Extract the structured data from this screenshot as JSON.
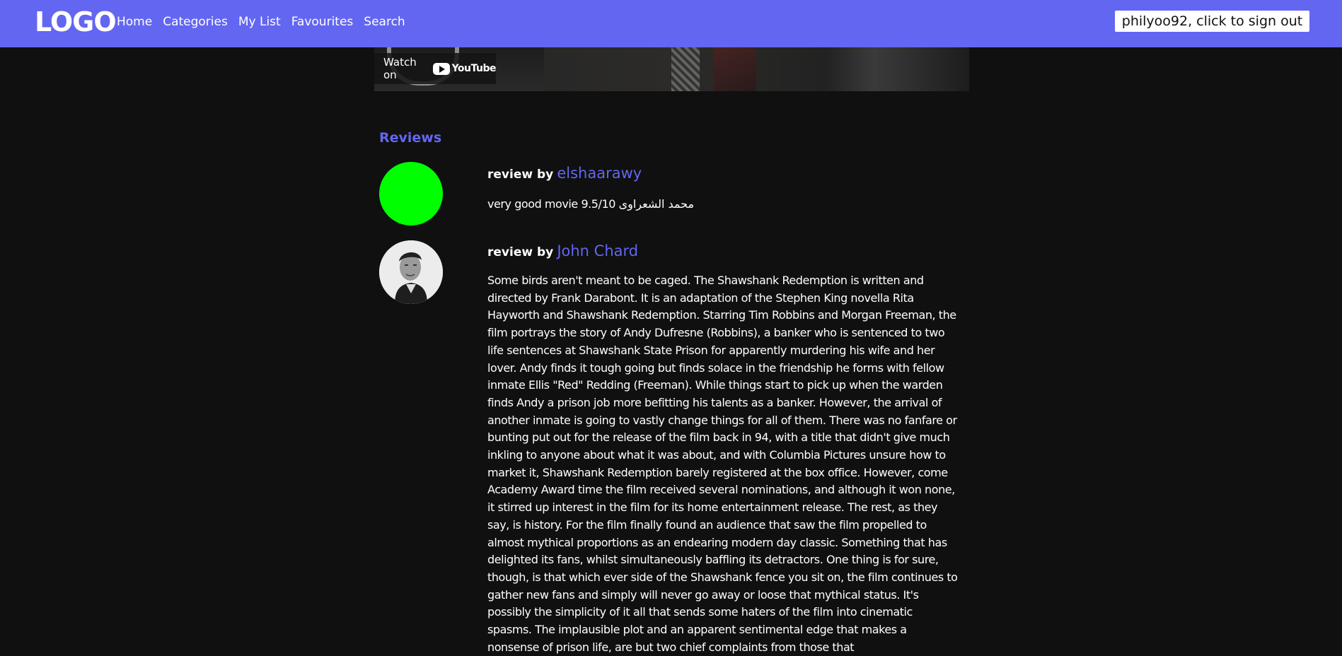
{
  "nav": {
    "logo": "LOGO",
    "links": [
      "Home",
      "Categories",
      "My List",
      "Favourites",
      "Search"
    ],
    "signout_label": "philyoo92, click to sign out"
  },
  "video": {
    "watch_on": "Watch on",
    "youtube_word": "YouTube"
  },
  "reviews": {
    "heading": "Reviews",
    "items": [
      {
        "by_label": "review by",
        "author": "elshaarawy",
        "avatar_color": "#00ff00",
        "text": "very good movie 9.5/10 محمد الشعراوى"
      },
      {
        "by_label": "review by",
        "author": "John Chard",
        "text": "Some birds aren't meant to be caged. The Shawshank Redemption is written and directed by Frank Darabont. It is an adaptation of the Stephen King novella Rita Hayworth and Shawshank Redemption. Starring Tim Robbins and Morgan Freeman, the film portrays the story of Andy Dufresne (Robbins), a banker who is sentenced to two life sentences at Shawshank State Prison for apparently murdering his wife and her lover. Andy finds it tough going but finds solace in the friendship he forms with fellow inmate Ellis \"Red\" Redding (Freeman). While things start to pick up when the warden finds Andy a prison job more befitting his talents as a banker. However, the arrival of another inmate is going to vastly change things for all of them. There was no fanfare or bunting put out for the release of the film back in 94, with a title that didn't give much inkling to anyone about what it was about, and with Columbia Pictures unsure how to market it, Shawshank Redemption barely registered at the box office. However, come Academy Award time the film received several nominations, and although it won none, it stirred up interest in the film for its home entertainment release. The rest, as they say, is history. For the film finally found an audience that saw the film propelled to almost mythical proportions as an endearing modern day classic. Something that has delighted its fans, whilst simultaneously baffling its detractors. One thing is for sure, though, is that which ever side of the Shawshank fence you sit on, the film continues to gather new fans and simply will never go away or loose that mythical status. It's possibly the simplicity of it all that sends some haters of the film into cinematic spasms. The implausible plot and an apparent sentimental edge that makes a nonsense of prison life, are but two chief complaints from those that"
      }
    ]
  },
  "colors": {
    "accent": "#6366f1",
    "background": "#101010"
  }
}
